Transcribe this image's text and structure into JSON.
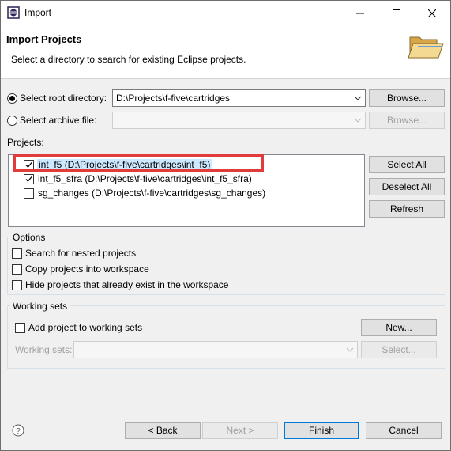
{
  "window": {
    "title": "Import"
  },
  "header": {
    "title": "Import Projects",
    "description": "Select a directory to search for existing Eclipse projects."
  },
  "source": {
    "root_label": "Select root directory:",
    "root_value": "D:\\Projects\\f-five\\cartridges",
    "archive_label": "Select archive file:",
    "archive_value": "",
    "browse": "Browse...",
    "browse_archive": "Browse..."
  },
  "projects": {
    "label": "Projects:",
    "items": [
      {
        "label": "int_f5 (D:\\Projects\\f-five\\cartridges\\int_f5)",
        "checked": true,
        "selected": true
      },
      {
        "label": "int_f5_sfra (D:\\Projects\\f-five\\cartridges\\int_f5_sfra)",
        "checked": true,
        "selected": false
      },
      {
        "label": "sg_changes (D:\\Projects\\f-five\\cartridges\\sg_changes)",
        "checked": false,
        "selected": false
      }
    ],
    "select_all": "Select All",
    "deselect_all": "Deselect All",
    "refresh": "Refresh"
  },
  "options": {
    "title": "Options",
    "items": [
      "Search for nested projects",
      "Copy projects into workspace",
      "Hide projects that already exist in the workspace"
    ]
  },
  "working_sets": {
    "title": "Working sets",
    "add_label": "Add project to working sets",
    "new": "New...",
    "sets_label": "Working sets:",
    "select": "Select..."
  },
  "footer": {
    "back": "< Back",
    "next": "Next >",
    "finish": "Finish",
    "cancel": "Cancel"
  },
  "colors": {
    "accent": "#0078d7",
    "highlight": "#e03c3c",
    "selection": "#cce8ff"
  }
}
